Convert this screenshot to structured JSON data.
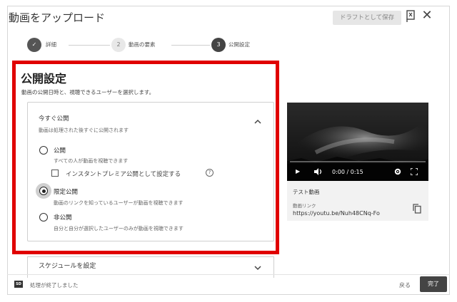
{
  "header": {
    "title": "動画をアップロード",
    "draft_button": "ドラフトとして保存"
  },
  "stepper": {
    "steps": [
      {
        "number": "✓",
        "label": "詳細",
        "state": "done"
      },
      {
        "number": "2",
        "label": "動画の要素",
        "state": "todo"
      },
      {
        "number": "3",
        "label": "公開設定",
        "state": "active"
      }
    ]
  },
  "visibility": {
    "title": "公開設定",
    "description": "動画の公開日時と、視聴できるユーザーを選択します。",
    "publish_now": {
      "title": "今すぐ公開",
      "subtitle": "動画は処理された後すぐに公開されます"
    },
    "options": [
      {
        "label": "公開",
        "description": "すべての人が動画を視聴できます",
        "selected": false
      },
      {
        "label": "限定公開",
        "description": "動画のリンクを知っているユーザーが動画を視聴できます",
        "selected": true
      },
      {
        "label": "非公開",
        "description": "自分と自分が選択したユーザーのみが動画を視聴できます",
        "selected": false
      }
    ],
    "premiere_checkbox": {
      "label": "インスタントプレミア公開として設定する",
      "checked": false
    },
    "help_glyph": "?"
  },
  "schedule": {
    "label": "スケジュールを設定"
  },
  "video": {
    "time": "0:00 / 0:15",
    "progress": 0.0,
    "title": "テスト動画",
    "link_label": "動画リンク",
    "link_url": "https://youtu.be/Nuh48CNq-Fo"
  },
  "footer": {
    "badge": "SD",
    "status": "処理が終了しました",
    "back": "戻る",
    "done": "完了"
  },
  "colors": {
    "highlight": "#e00000",
    "primary_button": "#444444"
  }
}
